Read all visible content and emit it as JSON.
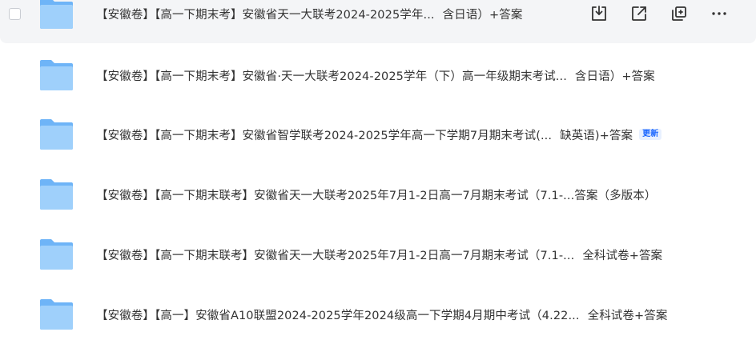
{
  "files": [
    {
      "name_start": "【安徽卷】【高一下期末考】安徽省天一大联考2024-2025学年...",
      "name_end": "含日语）+答案",
      "badge": "",
      "hovered": true
    },
    {
      "name_start": "【安徽卷】【高一下期末考】安徽省·天一大联考2024-2025学年（下）高一年级期末考试...",
      "name_end": "含日语）+答案",
      "badge": "",
      "hovered": false
    },
    {
      "name_start": "【安徽卷】【高一下期末考】安徽省智学联考2024-2025学年高一下学期7月期末考试(...",
      "name_end": "缺英语)+答案",
      "badge": "更新",
      "hovered": false
    },
    {
      "name_start": "【安徽卷】【高一下期末联考】安徽省天一大联考2025年7月1-2日高一7月期末考试（7.1-...",
      "name_end": "答案（多版本）",
      "badge": "",
      "hovered": false,
      "tight": true
    },
    {
      "name_start": "【安徽卷】【高一下期末联考】安徽省天一大联考2025年7月1-2日高一7月期末考试（7.1-...",
      "name_end": "全科试卷+答案",
      "badge": "",
      "hovered": false
    },
    {
      "name_start": "【安徽卷】【高一】安徽省A10联盟2024-2025学年2024级高一下学期4月期中考试（4.22...",
      "name_end": "全科试卷+答案",
      "badge": "",
      "hovered": false
    }
  ],
  "row_actions": [
    {
      "icon": "download-icon"
    },
    {
      "icon": "share-icon"
    },
    {
      "icon": "copy-icon"
    },
    {
      "icon": "more-icon"
    }
  ],
  "colors": {
    "folder_back": "#6eb4f7",
    "folder_front": "#9fd0fb",
    "hover_bg": "#f4f5f7",
    "badge_text": "#1a66ff"
  }
}
